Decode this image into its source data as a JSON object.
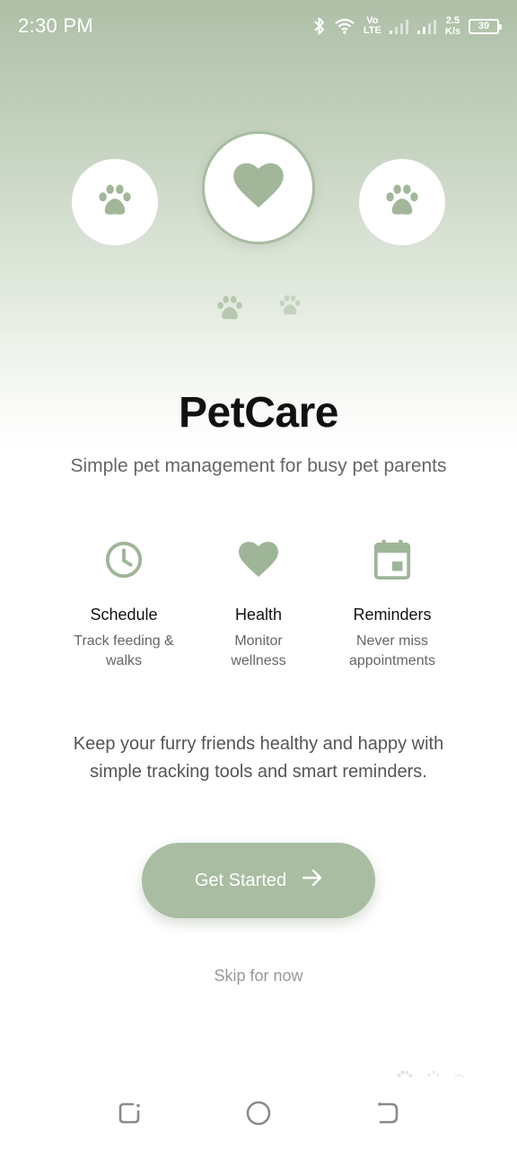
{
  "status_bar": {
    "time": "2:30 PM",
    "volte_top": "Vo",
    "volte_bottom": "LTE",
    "speed_value": "2.5",
    "speed_unit": "K/s",
    "battery": "39",
    "icons": [
      "bluetooth-icon",
      "wifi-icon",
      "signal-icon",
      "signal-icon",
      "battery-icon"
    ]
  },
  "hero": {
    "icons": [
      "paw-icon",
      "heart-icon",
      "paw-icon",
      "paw-icon",
      "paw-icon"
    ]
  },
  "app": {
    "title": "PetCare",
    "subtitle": "Simple pet management for busy pet parents"
  },
  "features": [
    {
      "icon": "clock-icon",
      "title": "Schedule",
      "desc_line1": "Track feeding &",
      "desc_line2": "walks"
    },
    {
      "icon": "heart-icon",
      "title": "Health",
      "desc_line1": "Monitor",
      "desc_line2": "wellness"
    },
    {
      "icon": "calendar-icon",
      "title": "Reminders",
      "desc_line1": "Never miss",
      "desc_line2": "appointments"
    }
  ],
  "description": {
    "line1": "Keep your furry friends healthy and happy with",
    "line2": "simple tracking tools and smart reminders."
  },
  "cta": {
    "label": "Get Started",
    "icon": "arrow-right-icon"
  },
  "skip": {
    "label": "Skip for now"
  },
  "nav": {
    "icons": [
      "recents-icon",
      "home-icon",
      "back-icon"
    ]
  },
  "colors": {
    "accent": "#a8bda2",
    "icon": "#9fb597",
    "title": "#111111",
    "muted_text": "#666666"
  }
}
